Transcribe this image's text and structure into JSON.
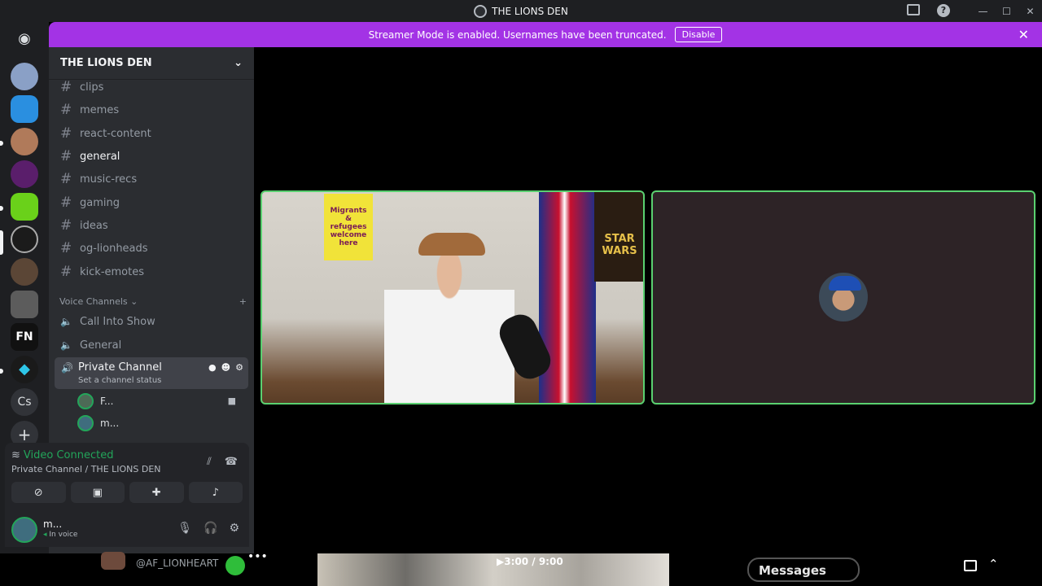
{
  "window": {
    "title": "THE LIONS DEN"
  },
  "banner": {
    "text": "Streamer Mode is enabled. Usernames have been truncated.",
    "disable_label": "Disable"
  },
  "guild": {
    "name": "THE LIONS DEN"
  },
  "server_rail": {
    "discord_icon": "discord-logo-icon",
    "cs_label": "Cs",
    "add_label": "+"
  },
  "text_channels": [
    {
      "name": "clips"
    },
    {
      "name": "memes"
    },
    {
      "name": "react-content"
    },
    {
      "name": "general",
      "active": true
    },
    {
      "name": "music-recs"
    },
    {
      "name": "gaming"
    },
    {
      "name": "ideas"
    },
    {
      "name": "og-lionheads"
    },
    {
      "name": "kick-emotes"
    }
  ],
  "voice": {
    "header": "Voice Channels",
    "channels": [
      {
        "name": "Call Into Show"
      },
      {
        "name": "General"
      }
    ],
    "private": {
      "name": "Private Channel",
      "status": "Set a channel status"
    },
    "members": [
      {
        "name": "F..."
      },
      {
        "name": "m..."
      }
    ]
  },
  "voice_panel": {
    "status": "Video Connected",
    "channel": "Private Channel / THE LIONS DEN"
  },
  "user": {
    "name": "m...",
    "status": "In voice"
  },
  "video": {
    "sign_text": "Migrants & refugees welcome here",
    "poster_text": "STAR WARS"
  },
  "bottom": {
    "handle": "@AF_LIONHEART",
    "timecode": "3:00 / 9:00",
    "messages_label": "Messages"
  },
  "colors": {
    "brand": "#a333e5",
    "connected": "#23a55a",
    "speaking_border": "#5ad070"
  }
}
